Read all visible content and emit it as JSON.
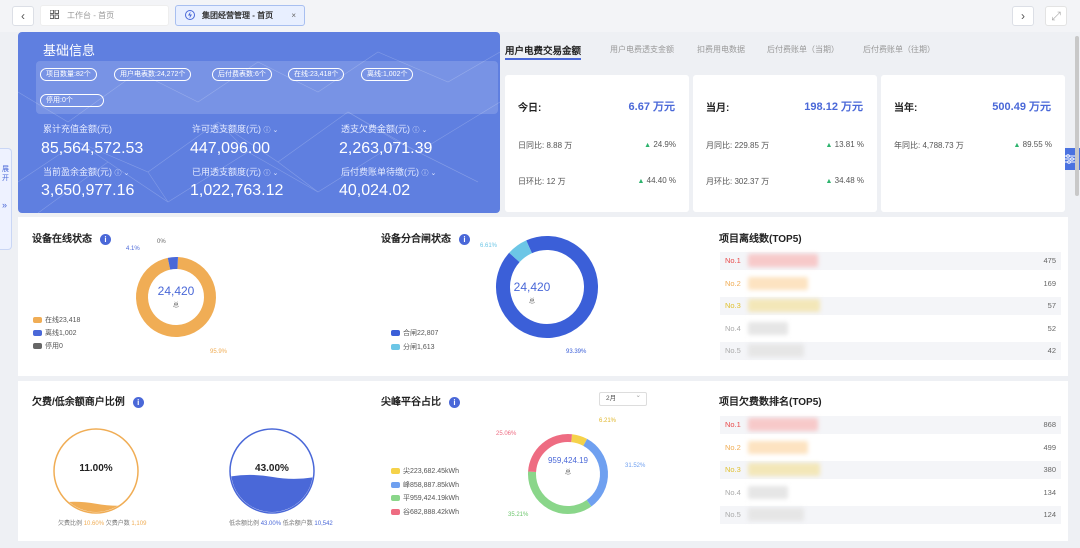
{
  "tabs": {
    "t1": "工作台 - 首页",
    "t2": "集团经营管理 - 首页",
    "close": "×",
    "back": "‹",
    "forward": "›",
    "expand": "⤢"
  },
  "side": {
    "handle": "展开",
    "chev": "»",
    "filter": "⚙"
  },
  "basic": {
    "title": "基础信息",
    "tags": [
      "项目数量:82个",
      "用户电表数:24,272个",
      "后付费表数:6个",
      "在线:23,418个",
      "离线:1,002个",
      "停用:0个"
    ],
    "stats": [
      {
        "label": "累计充值金额(元)",
        "value": "85,564,572.53"
      },
      {
        "label": "许可透支额度(元)",
        "value": "447,096.00"
      },
      {
        "label": "透支欠费金额(元)",
        "value": "2,263,071.39"
      },
      {
        "label": "当前盈余金额(元)",
        "value": "3,650,977.16"
      },
      {
        "label": "已用透支额度(元)",
        "value": "1,022,763.12"
      },
      {
        "label": "后付费账单待缴(元)",
        "value": "40,024.02"
      }
    ]
  },
  "topTabs": [
    "用户电费交易金额",
    "用户电费透支金额",
    "扣费用电数据",
    "后付费账单（当期）",
    "后付费账单（往期）"
  ],
  "cards": [
    {
      "label": "今日:",
      "value": "6.67 万元",
      "r1": {
        "l": "日同比: 8.88 万",
        "p": "24.9%"
      },
      "r2": {
        "l": "日环比: 12 万",
        "p": "44.40 %"
      }
    },
    {
      "label": "当月:",
      "value": "198.12 万元",
      "r1": {
        "l": "月同比: 229.85 万",
        "p": "13.81 %"
      },
      "r2": {
        "l": "月环比: 302.37 万",
        "p": "34.48 %"
      }
    },
    {
      "label": "当年:",
      "value": "500.49 万元",
      "r1": {
        "l": "年同比: 4,788.73 万",
        "p": "89.55 %"
      }
    }
  ],
  "arrowUp": "▲",
  "online": {
    "title": "设备在线状态",
    "total": "24,420",
    "unit": "总",
    "labels": [
      "4.1%",
      "0%",
      "95.9%"
    ],
    "legend": [
      "在线23,418",
      "离线1,002",
      "停用0"
    ],
    "colors": [
      "#f0ad55",
      "#4a68d8",
      "#666666"
    ],
    "values": [
      23418,
      1002,
      0
    ]
  },
  "switch": {
    "title": "设备分合闸状态",
    "total": "24,420",
    "unit": "总",
    "labels": [
      "6.61%",
      "93.39%"
    ],
    "legend": [
      "合闸22,807",
      "分闸1,613"
    ],
    "colors": [
      "#3b5fd8",
      "#6cc6e6"
    ],
    "values": [
      22807,
      1613
    ]
  },
  "offline": {
    "title": "项目离线数(TOP5)",
    "rows": [
      {
        "no": "No.1",
        "v": "475"
      },
      {
        "no": "No.2",
        "v": "169"
      },
      {
        "no": "No.3",
        "v": "57"
      },
      {
        "no": "No.4",
        "v": "52"
      },
      {
        "no": "No.5",
        "v": "42"
      }
    ]
  },
  "arrears": {
    "title": "欠费/低余额商户比例",
    "p1": "11.00%",
    "p2": "43.00%",
    "c1a": "欠费比例",
    "c1b": "10.60%",
    "c1c": "欠费户数",
    "c1d": "1,109",
    "c2a": "低余额比例",
    "c2b": "43.00%",
    "c2c": "低余额户数",
    "c2d": "10,542",
    "fill1": 0.11,
    "fill2": 0.43
  },
  "peak": {
    "title": "尖峰平谷占比",
    "select": "2月",
    "total": "959,424.19",
    "unit": "总",
    "labels": [
      "6.21%",
      "31.52%",
      "35.21%",
      "25.06%"
    ],
    "legend": [
      "尖223,682.45kWh",
      "峰858,887.85kWh",
      "平959,424.19kWh",
      "谷682,888.42kWh"
    ],
    "colors": [
      "#f5d24a",
      "#6fa0f0",
      "#8ad68a",
      "#ee6c82"
    ],
    "values": [
      6.21,
      31.52,
      35.21,
      25.06
    ]
  },
  "debt": {
    "title": "项目欠费数排名(TOP5)",
    "rows": [
      {
        "no": "No.1",
        "v": "868"
      },
      {
        "no": "No.2",
        "v": "499"
      },
      {
        "no": "No.3",
        "v": "380"
      },
      {
        "no": "No.4",
        "v": "134"
      },
      {
        "no": "No.5",
        "v": "124"
      }
    ]
  }
}
